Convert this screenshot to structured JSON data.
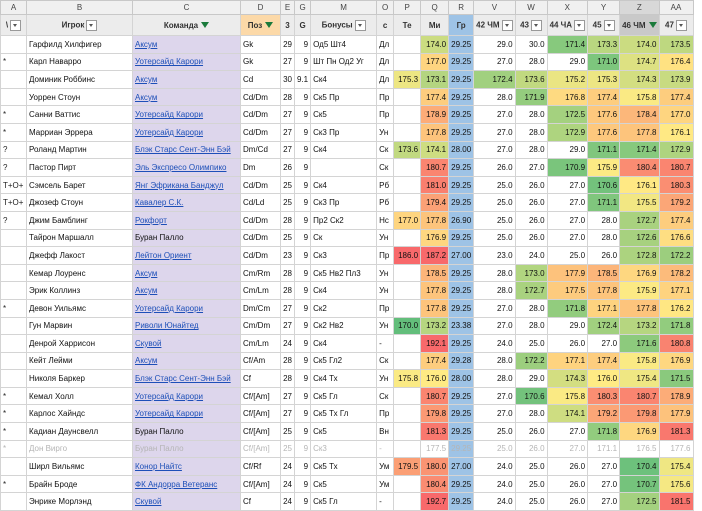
{
  "column_letters": [
    "A",
    "B",
    "C",
    "D",
    "E",
    "G",
    "M",
    "O",
    "P",
    "Q",
    "R",
    "V",
    "W",
    "X",
    "Y",
    "Z",
    "AA"
  ],
  "headers": {
    "mark": "\\",
    "player": "Игрок",
    "team": "Команда",
    "pos": "Поз",
    "e": "3",
    "g": "G",
    "bonus": "Бонусы",
    "o": "с",
    "p": "Те",
    "q": "Ми",
    "r": "Гр",
    "v": "42 ЧМ",
    "w": "43",
    "x": "44 ЧА",
    "y": "45",
    "z": "46 ЧМ",
    "aa": "47"
  },
  "rows": [
    {
      "mark": "",
      "name": "Гарфилд Хилфигер",
      "team": "Аксум",
      "team_link": true,
      "pos": "Gk",
      "e": "29",
      "g": "9",
      "bonus": "Од5 Шт4",
      "o": "Дл",
      "p": "",
      "q": "174.0",
      "r": "29.25",
      "v": "29.0",
      "w": "30.0",
      "x": "171.4",
      "y": "173.3",
      "z": "174.0",
      "aa": "173.5"
    },
    {
      "mark": "*",
      "name": "Карл Наварро",
      "team": "Уотерсайд Карори",
      "team_link": true,
      "pos": "Gk",
      "e": "27",
      "g": "9",
      "bonus": "Шт Пн Од2 Уг",
      "o": "Дл",
      "p": "",
      "q": "177.0",
      "r": "29.25",
      "v": "27.0",
      "w": "28.0",
      "x": "29.0",
      "y": "171.0",
      "z": "174.7",
      "aa": "176.4"
    },
    {
      "mark": "",
      "name": "Доминик Роббинс",
      "team": "Аксум",
      "team_link": true,
      "pos": "Cd",
      "e": "30",
      "g": "9.1",
      "bonus": "Ск4",
      "o": "Дл",
      "p": "175.3",
      "q": "173.1",
      "r": "29.25",
      "v": "172.4",
      "w": "173.6",
      "x": "175.2",
      "y": "175.3",
      "z": "174.3",
      "aa": "173.9"
    },
    {
      "mark": "",
      "name": "Уоррен Стоун",
      "team": "Аксум",
      "team_link": true,
      "pos": "Cd/Dm",
      "e": "28",
      "g": "9",
      "bonus": "Ск5 Пр",
      "o": "Пр",
      "p": "",
      "q": "177.4",
      "r": "29.25",
      "v": "28.0",
      "w": "171.9",
      "x": "176.8",
      "y": "177.4",
      "z": "175.8",
      "aa": "177.4"
    },
    {
      "mark": "*",
      "name": "Санни Ваттис",
      "team": "Уотерсайд Карори",
      "team_link": true,
      "pos": "Cd/Dm",
      "e": "27",
      "g": "9",
      "bonus": "Ск5",
      "o": "Пр",
      "p": "",
      "q": "178.9",
      "r": "29.25",
      "v": "27.0",
      "w": "28.0",
      "x": "172.5",
      "y": "177.6",
      "z": "178.4",
      "aa": "177.0"
    },
    {
      "mark": "*",
      "name": "Марриан Эррера",
      "team": "Уотерсайд Карори",
      "team_link": true,
      "pos": "Cd/Dm",
      "e": "27",
      "g": "9",
      "bonus": "Ск3 Пр",
      "o": "Ун",
      "p": "",
      "q": "177.8",
      "r": "29.25",
      "v": "27.0",
      "w": "28.0",
      "x": "172.9",
      "y": "177.6",
      "z": "177.8",
      "aa": "176.1"
    },
    {
      "mark": "?",
      "name": "Роланд Мартин",
      "team": "Блэк Старс Сент-Энн Бэй",
      "team_link": true,
      "pos": "Dm/Cd",
      "e": "27",
      "g": "9",
      "bonus": "Ск4",
      "o": "Ск",
      "p": "173.6",
      "q": "174.1",
      "r": "28.00",
      "v": "27.0",
      "w": "28.0",
      "x": "29.0",
      "y": "171.1",
      "z": "171.4",
      "aa": "172.9"
    },
    {
      "mark": "?",
      "name": "Пастор Пирт",
      "team": "Эль Экспресо Олимпико",
      "team_link": true,
      "pos": "Dm",
      "e": "26",
      "g": "9",
      "bonus": "",
      "o": "Ск",
      "p": "",
      "q": "180.7",
      "r": "29.25",
      "v": "26.0",
      "w": "27.0",
      "x": "170.9",
      "y": "175.9",
      "z": "180.4",
      "aa": "180.7"
    },
    {
      "mark": "Т+О+",
      "name": "Сэмсель Барет",
      "team": "Янг Эфрикана Банджул",
      "team_link": true,
      "pos": "Cd/Dm",
      "e": "25",
      "g": "9",
      "bonus": "Ск4",
      "o": "Рб",
      "p": "",
      "q": "181.0",
      "r": "29.25",
      "v": "25.0",
      "w": "26.0",
      "x": "27.0",
      "y": "170.6",
      "z": "176.1",
      "aa": "180.3"
    },
    {
      "mark": "Т+О+",
      "name": "Джозеф Стоун",
      "team": "Кавалер С.К.",
      "team_link": true,
      "pos": "Cd/Ld",
      "e": "25",
      "g": "9",
      "bonus": "Ск3 Пр",
      "o": "Рб",
      "p": "",
      "q": "179.4",
      "r": "29.25",
      "v": "25.0",
      "w": "26.0",
      "x": "27.0",
      "y": "171.1",
      "z": "175.5",
      "aa": "179.2"
    },
    {
      "mark": "?",
      "name": "Джим Бамблинг",
      "team": "Рокфорт",
      "team_link": true,
      "pos": "Cd/Dm",
      "e": "28",
      "g": "9",
      "bonus": "Пр2 Ск2",
      "o": "Нс",
      "p": "177.0",
      "q": "177.8",
      "r": "26.90",
      "v": "25.0",
      "w": "26.0",
      "x": "27.0",
      "y": "28.0",
      "z": "172.7",
      "aa": "177.4"
    },
    {
      "mark": "",
      "name": "Тайрон Маршалл",
      "team": "Буран Палло",
      "team_link": false,
      "pos": "Cd/Dm",
      "e": "25",
      "g": "9",
      "bonus": "Ск",
      "o": "Ун",
      "p": "",
      "q": "176.9",
      "r": "29.25",
      "v": "25.0",
      "w": "26.0",
      "x": "27.0",
      "y": "28.0",
      "z": "172.6",
      "aa": "176.6"
    },
    {
      "mark": "",
      "name": "Джефф Лакост",
      "team": "Лейтон Ориент",
      "team_link": true,
      "pos": "Cd/Dm",
      "e": "23",
      "g": "9",
      "bonus": "Ск3",
      "o": "Пр",
      "p": "186.0",
      "q": "187.2",
      "r": "27.00",
      "v": "23.0",
      "w": "24.0",
      "x": "25.0",
      "y": "26.0",
      "z": "172.8",
      "aa": "172.2"
    },
    {
      "mark": "",
      "name": "Кемар Лоуренс",
      "team": "Аксум",
      "team_link": true,
      "pos": "Cm/Rm",
      "e": "28",
      "g": "9",
      "bonus": "Ск5 Нв2 Пл3",
      "o": "Ун",
      "p": "",
      "q": "178.5",
      "r": "29.25",
      "v": "28.0",
      "w": "173.0",
      "x": "177.9",
      "y": "178.5",
      "z": "176.9",
      "aa": "178.2"
    },
    {
      "mark": "",
      "name": "Эрик Коллинз",
      "team": "Аксум",
      "team_link": true,
      "pos": "Cm/Lm",
      "e": "28",
      "g": "9",
      "bonus": "Ск4",
      "o": "Ун",
      "p": "",
      "q": "177.8",
      "r": "29.25",
      "v": "28.0",
      "w": "172.7",
      "x": "177.5",
      "y": "177.8",
      "z": "175.9",
      "aa": "177.1"
    },
    {
      "mark": "*",
      "name": "Девон Уильямс",
      "team": "Уотерсайд Карори",
      "team_link": true,
      "pos": "Dm/Cm",
      "e": "27",
      "g": "9",
      "bonus": "Ск2",
      "o": "Пр",
      "p": "",
      "q": "177.8",
      "r": "29.25",
      "v": "27.0",
      "w": "28.0",
      "x": "171.8",
      "y": "177.1",
      "z": "177.8",
      "aa": "176.2"
    },
    {
      "mark": "",
      "name": "Гун Марвин",
      "team": "Риволи Юнайтед",
      "team_link": true,
      "pos": "Cm/Dm",
      "e": "27",
      "g": "9",
      "bonus": "Ск2 Нв2",
      "o": "Ун",
      "p": "170.0",
      "q": "173.2",
      "r": "23.38",
      "v": "27.0",
      "w": "28.0",
      "x": "29.0",
      "y": "172.4",
      "z": "173.2",
      "aa": "171.8"
    },
    {
      "mark": "",
      "name": "Денрой Харрисон",
      "team": "Скувой",
      "team_link": true,
      "pos": "Cm/Lm",
      "e": "24",
      "g": "9",
      "bonus": "Ск4",
      "o": "-",
      "p": "",
      "q": "192.1",
      "r": "29.25",
      "v": "24.0",
      "w": "25.0",
      "x": "26.0",
      "y": "27.0",
      "z": "171.6",
      "aa": "180.8"
    },
    {
      "mark": "",
      "name": "Кейт Лейми",
      "team": "Аксум",
      "team_link": true,
      "pos": "Cf/Am",
      "e": "28",
      "g": "9",
      "bonus": "Ск5 Гл2",
      "o": "Ск",
      "p": "",
      "q": "177.4",
      "r": "29.28",
      "v": "28.0",
      "w": "172.2",
      "x": "177.1",
      "y": "177.4",
      "z": "175.8",
      "aa": "176.9"
    },
    {
      "mark": "",
      "name": "Николя Баркер",
      "team": "Блэк Старс Сент-Энн Бэй",
      "team_link": true,
      "pos": "Cf",
      "e": "28",
      "g": "9",
      "bonus": "Ск4 Тх",
      "o": "Ун",
      "p": "175.8",
      "q": "176.0",
      "r": "28.00",
      "v": "28.0",
      "w": "29.0",
      "x": "174.3",
      "y": "176.0",
      "z": "175.4",
      "aa": "171.5"
    },
    {
      "mark": "*",
      "name": "Кемал Холл",
      "team": "Уотерсайд Карори",
      "team_link": true,
      "pos": "Cf/[Am]",
      "e": "27",
      "g": "9",
      "bonus": "Ск5 Гл",
      "o": "Ск",
      "p": "",
      "q": "180.7",
      "r": "29.25",
      "v": "27.0",
      "w": "170.6",
      "x": "175.8",
      "y": "180.3",
      "z": "180.7",
      "aa": "178.9"
    },
    {
      "mark": "*",
      "name": "Карлос Хайндс",
      "team": "Уотерсайд Карори",
      "team_link": true,
      "pos": "Cf/[Am]",
      "e": "27",
      "g": "9",
      "bonus": "Ск5 Тх Гл",
      "o": "Пр",
      "p": "",
      "q": "179.8",
      "r": "29.25",
      "v": "27.0",
      "w": "28.0",
      "x": "174.1",
      "y": "179.2",
      "z": "179.8",
      "aa": "177.9"
    },
    {
      "mark": "*",
      "name": "Кадиан Даунсвелл",
      "team": "Буран Палло",
      "team_link": false,
      "pos": "Cf/[Am]",
      "e": "25",
      "g": "9",
      "bonus": "Ск5",
      "o": "Вн",
      "p": "",
      "q": "181.3",
      "r": "29.25",
      "v": "25.0",
      "w": "26.0",
      "x": "27.0",
      "y": "171.8",
      "z": "176.9",
      "aa": "181.3"
    },
    {
      "mark": "*",
      "name": "Дон Вирго",
      "team": "Буран Палло",
      "team_link": false,
      "pos": "Cf/[Am]",
      "e": "25",
      "g": "9",
      "bonus": "Ск3",
      "o": "-",
      "p": "",
      "q": "177.5",
      "r": "29.25",
      "v": "25.0",
      "w": "26.0",
      "x": "27.0",
      "y": "171.1",
      "z": "176.5",
      "aa": "177.6",
      "dim": true
    },
    {
      "mark": "",
      "name": "Ширл Вильямс",
      "team": "Конор Найтс",
      "team_link": true,
      "pos": "Cf/Rf",
      "e": "24",
      "g": "9",
      "bonus": "Ск5 Тх",
      "o": "Ум",
      "p": "179.5",
      "q": "180.0",
      "r": "27.00",
      "v": "24.0",
      "w": "25.0",
      "x": "26.0",
      "y": "27.0",
      "z": "170.4",
      "aa": "175.4"
    },
    {
      "mark": "*",
      "name": "Брайн Броде",
      "team": "ФК Андорра Ветеранс",
      "team_link": true,
      "pos": "Cf/[Am]",
      "e": "24",
      "g": "9",
      "bonus": "Ск5",
      "o": "Ум",
      "p": "",
      "q": "180.4",
      "r": "29.25",
      "v": "24.0",
      "w": "25.0",
      "x": "26.0",
      "y": "27.0",
      "z": "170.7",
      "aa": "175.6"
    },
    {
      "mark": "",
      "name": "Энрике Морлэнд",
      "team": "Скувой",
      "team_link": true,
      "pos": "Cf",
      "e": "24",
      "g": "9",
      "bonus": "Ск5 Гл",
      "o": "-",
      "p": "",
      "q": "192.7",
      "r": "29.25",
      "v": "24.0",
      "w": "25.0",
      "x": "26.0",
      "y": "27.0",
      "z": "172.5",
      "aa": "181.5"
    }
  ]
}
